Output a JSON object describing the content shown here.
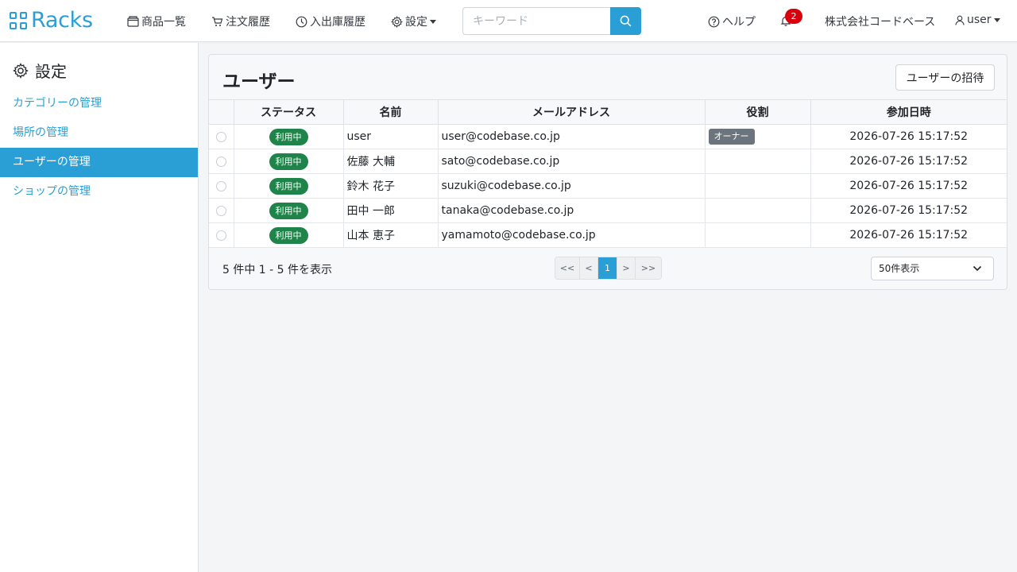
{
  "header": {
    "logo": "Racks",
    "nav": [
      {
        "label": "商品一覧",
        "icon": "box-icon"
      },
      {
        "label": "注文履歴",
        "icon": "cart-icon"
      },
      {
        "label": "入出庫履歴",
        "icon": "clock-icon"
      },
      {
        "label": "設定",
        "icon": "gear-icon"
      }
    ],
    "search_placeholder": "キーワード",
    "help": "ヘルプ",
    "notifications": "2",
    "company": "株式会社コードベース",
    "user": "user"
  },
  "sidebar": {
    "title": "設定",
    "items": [
      {
        "label": "カテゴリーの管理",
        "active": false
      },
      {
        "label": "場所の管理",
        "active": false
      },
      {
        "label": "ユーザーの管理",
        "active": true
      },
      {
        "label": "ショップの管理",
        "active": false
      }
    ]
  },
  "main": {
    "title": "ユーザー",
    "invite_button": "ユーザーの招待",
    "columns": [
      "ステータス",
      "名前",
      "メールアドレス",
      "役割",
      "参加日時"
    ],
    "rows": [
      {
        "status": "利用中",
        "name": "user",
        "email": "user@codebase.co.jp",
        "role": "オーナー",
        "joined": "2026-07-26 15:17:52"
      },
      {
        "status": "利用中",
        "name": "佐藤 大輔",
        "email": "sato@codebase.co.jp",
        "role": "",
        "joined": "2026-07-26 15:17:52"
      },
      {
        "status": "利用中",
        "name": "鈴木 花子",
        "email": "suzuki@codebase.co.jp",
        "role": "",
        "joined": "2026-07-26 15:17:52"
      },
      {
        "status": "利用中",
        "name": "田中 一郎",
        "email": "tanaka@codebase.co.jp",
        "role": "",
        "joined": "2026-07-26 15:17:52"
      },
      {
        "status": "利用中",
        "name": "山本 恵子",
        "email": "yamamoto@codebase.co.jp",
        "role": "",
        "joined": "2026-07-26 15:17:52"
      }
    ],
    "summary": "5 件中 1 - 5 件を表示",
    "pagination": [
      "<<",
      "<",
      "1",
      ">",
      ">>"
    ],
    "current_page": "1",
    "per_page": "50件表示"
  },
  "colors": {
    "accent": "#2a9fd6",
    "status_green": "#1e8449",
    "role_gray": "#6c757d",
    "notify_red": "#d9000d"
  }
}
